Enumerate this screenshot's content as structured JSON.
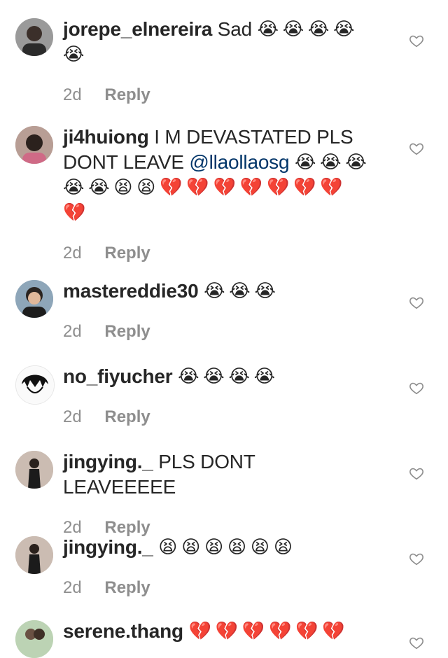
{
  "icons": {
    "crying": "😭",
    "tired": "😫",
    "heart_broken": "💔"
  },
  "colors": {
    "text": "#262626",
    "secondary": "#8e8e8e",
    "mention": "#003569"
  },
  "comments": [
    {
      "username": "jorepe_elnereira",
      "text": "Sad",
      "emojis": [
        "😭",
        "😭",
        "😭",
        "😭",
        "😭"
      ],
      "time": "2d",
      "reply_label": "Reply"
    },
    {
      "username": "ji4huiong",
      "text": "I M DEVASTATED PLS DONT LEAVE",
      "mention": "@llaollaosg",
      "emojis": [
        "😭",
        "😭",
        "😭",
        "😭",
        "😭",
        "😫",
        "😫",
        "💔",
        "💔",
        "💔",
        "💔",
        "💔",
        "💔",
        "💔",
        "💔"
      ],
      "time": "2d",
      "reply_label": "Reply"
    },
    {
      "username": "mastereddie30",
      "text": "",
      "emojis": [
        "😭",
        "😭",
        "😭"
      ],
      "time": "2d",
      "reply_label": "Reply"
    },
    {
      "username": "no_fiyucher",
      "text": "",
      "emojis": [
        "😭",
        "😭",
        "😭",
        "😭"
      ],
      "time": "2d",
      "reply_label": "Reply"
    },
    {
      "username": "jingying._",
      "text": "PLS DONT LEAVEEEEE",
      "emojis": [],
      "time": "2d",
      "reply_label": "Reply"
    },
    {
      "username": "jingying._",
      "text": "",
      "emojis": [
        "😫",
        "😫",
        "😫",
        "😫",
        "😫",
        "😫"
      ],
      "time": "2d",
      "reply_label": "Reply"
    },
    {
      "username": "serene.thang",
      "text": "",
      "emojis": [
        "💔",
        "💔",
        "💔",
        "💔",
        "💔",
        "💔"
      ],
      "time": "",
      "reply_label": ""
    }
  ]
}
